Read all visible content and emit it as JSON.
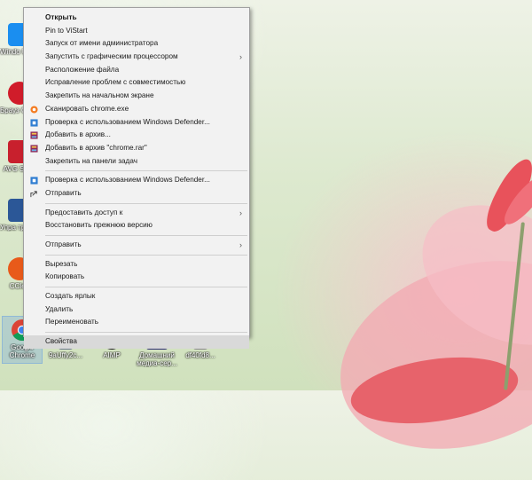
{
  "desktop": {
    "icons": [
      {
        "label": "Windo Updat",
        "color": "#1a8ef0"
      },
      {
        "label": "Брауз Opera",
        "color": "#d01c2a"
      },
      {
        "label": "AVG Secu",
        "color": "#c8202d"
      },
      {
        "label": "Упра трансф",
        "color": "#2b5797"
      },
      {
        "label": "CClea",
        "color": "#e85a1a"
      },
      {
        "label": "Google Chrome",
        "color": "#3a8f3a"
      }
    ],
    "bottom_icons": [
      {
        "label": "9aUffy2c..."
      },
      {
        "label": "AIMP"
      },
      {
        "label": "Домашний медиа-сер..."
      },
      {
        "label": "df40fd8..."
      }
    ]
  },
  "context_menu": {
    "items": [
      {
        "label": "Открыть",
        "bold": true
      },
      {
        "label": "Pin to ViStart"
      },
      {
        "label": "Запуск от имени администратора"
      },
      {
        "label": "Запустить с графическим процессором",
        "submenu": true
      },
      {
        "label": "Расположение файла"
      },
      {
        "label": "Исправление проблем с совместимостью"
      },
      {
        "label": "Закрепить на начальном экране"
      },
      {
        "label": "Сканировать chrome.exe",
        "icon": "avast-icon"
      },
      {
        "label": "Проверка с использованием Windows Defender...",
        "icon": "defender-icon"
      },
      {
        "label": "Добавить в архив...",
        "icon": "winrar-icon"
      },
      {
        "label": "Добавить в архив \"chrome.rar\"",
        "icon": "winrar-icon"
      },
      {
        "label": "Закрепить на панели задач"
      }
    ],
    "group2": [
      {
        "label": "Проверка с использованием Windows Defender...",
        "icon": "defender-icon"
      },
      {
        "label": "Отправить",
        "icon": "share-icon"
      }
    ],
    "group3": [
      {
        "label": "Предоставить доступ к",
        "submenu": true
      },
      {
        "label": "Восстановить прежнюю версию"
      }
    ],
    "group4": [
      {
        "label": "Отправить",
        "submenu": true
      }
    ],
    "group5": [
      {
        "label": "Вырезать"
      },
      {
        "label": "Копировать"
      }
    ],
    "group6": [
      {
        "label": "Создать ярлык"
      },
      {
        "label": "Удалить"
      },
      {
        "label": "Переименовать"
      }
    ],
    "group7": [
      {
        "label": "Свойства",
        "hover": true
      }
    ]
  }
}
